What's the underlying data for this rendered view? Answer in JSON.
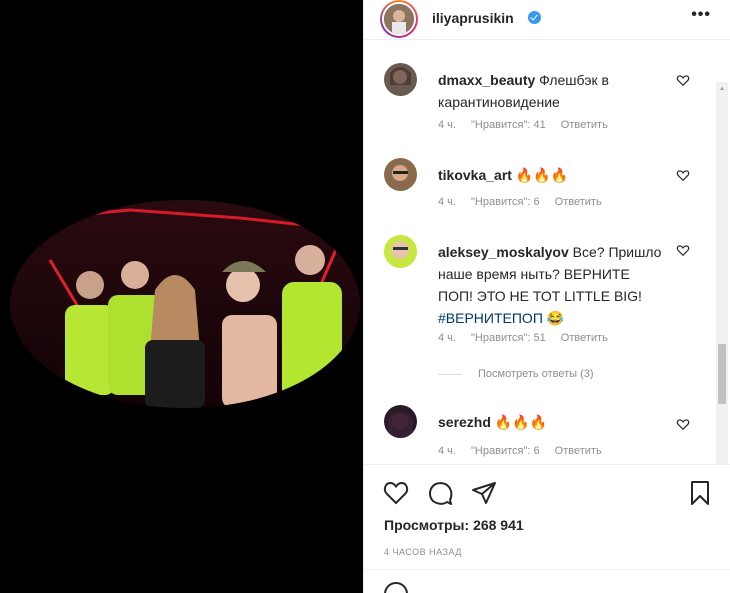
{
  "post": {
    "username": "iliyaprusikin",
    "more_icon": "•••"
  },
  "comments": [
    {
      "username": "dmaxx_beauty",
      "text": " Флешбэк в карантиновидение",
      "time": "4 ч.",
      "likes": "\"Нравится\": 41",
      "reply": "Ответить"
    },
    {
      "username": "tikovka_art",
      "text": " 🔥🔥🔥",
      "time": "4 ч.",
      "likes": "\"Нравится\": 6",
      "reply": "Ответить"
    },
    {
      "username": "aleksey_moskalyov",
      "text": " Все? Пришло наше время ныть? ВЕРНИТЕ ПОП! ЭТО НЕ ТОТ LITTLE BIG! ",
      "hashtag": "#ВЕРНИТЕПОП",
      "emoji": " 😂",
      "time": "4 ч.",
      "likes": "\"Нравится\": 51",
      "reply": "Ответить"
    },
    {
      "username": "serezhd",
      "text": " 🔥🔥🔥",
      "time": "4 ч.",
      "likes": "\"Нравится\": 6",
      "reply": "Ответить"
    }
  ],
  "view_replies": "Посмотреть ответы (3)",
  "views_label": "Просмотры:",
  "views_count": "268 941",
  "post_time": "4 часов назад",
  "colors": {
    "accent": "#3897f0",
    "hashtag": "#00376b",
    "muted": "#8e8e8e"
  }
}
